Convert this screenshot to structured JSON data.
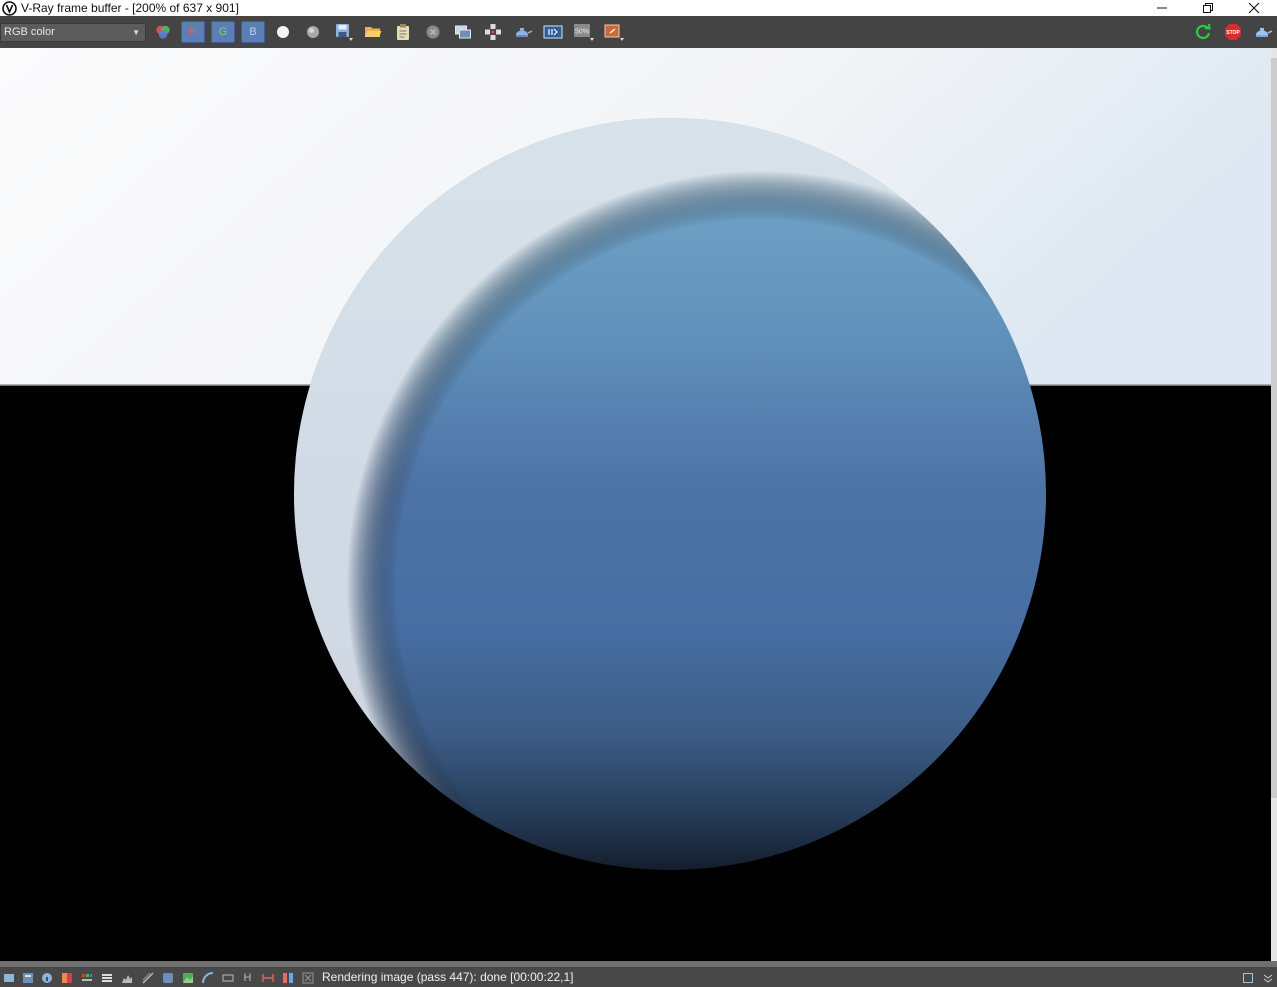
{
  "window": {
    "title": "V-Ray frame buffer - [200% of 637 x 901]"
  },
  "toolbar": {
    "channel": "RGB color",
    "red_label": "R",
    "green_label": "G",
    "blue_label": "B",
    "zoom_label": "50%",
    "icons": [
      "color-channels-icon",
      "red-channel-icon",
      "green-channel-icon",
      "blue-channel-icon",
      "monochrome-icon",
      "alpha-icon",
      "save-icon",
      "open-icon",
      "clear-icon",
      "clear-image-icon",
      "duplicate-to-history-icon",
      "track-mouse-icon",
      "render-region-icon",
      "lens-effects-icon",
      "compare-icon",
      "zoom-50-icon",
      "render-last-icon",
      "refresh-icon",
      "stop-icon",
      "render-icon"
    ]
  },
  "status": {
    "text": "Rendering image (pass 447): done [00:00:22,1]",
    "h_label": "H"
  },
  "colors": {
    "toolbar_bg": "#444444",
    "statusbar_bg": "#484848",
    "channel_button": "#5b7fb4",
    "sky": "#f4f6f8",
    "sphere_top": "#6fa3c5",
    "sphere_mid": "#4a6fa3",
    "sphere_bottom": "#1c2c42",
    "ground": "#000000"
  }
}
